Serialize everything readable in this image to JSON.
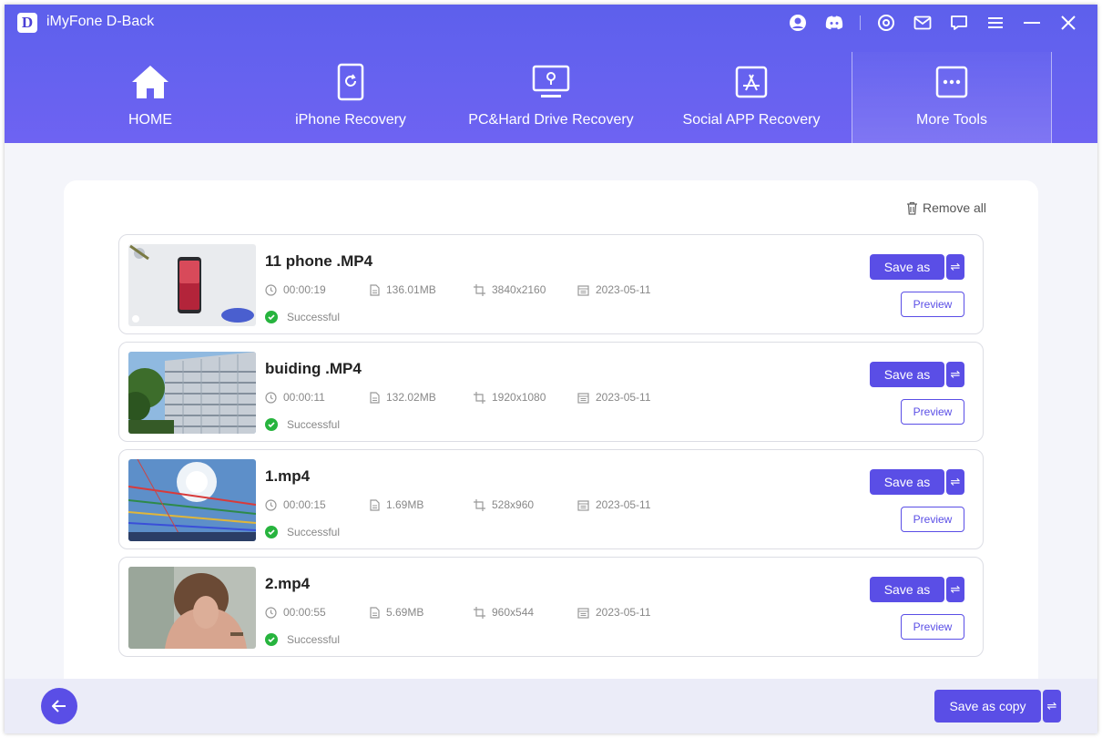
{
  "app": {
    "logo_letter": "D",
    "title": "iMyFone D-Back"
  },
  "titlebar_icons": [
    "user-icon",
    "discord-icon",
    "settings-icon",
    "mail-icon",
    "chat-icon",
    "menu-icon",
    "minimize-icon",
    "close-icon"
  ],
  "nav": [
    {
      "label": "HOME",
      "icon": "home-icon"
    },
    {
      "label": "iPhone Recovery",
      "icon": "iphone-recovery-icon"
    },
    {
      "label": "PC&Hard Drive Recovery",
      "icon": "pc-recovery-icon"
    },
    {
      "label": "Social APP Recovery",
      "icon": "app-store-icon"
    },
    {
      "label": "More Tools",
      "icon": "more-tools-icon",
      "active": true
    }
  ],
  "remove_all_label": "Remove all",
  "files": [
    {
      "name": "11 phone .MP4",
      "duration": "00:00:19",
      "size": "136.01MB",
      "resolution": "3840x2160",
      "date": "2023-05-11",
      "status": "Successful",
      "save_label": "Save as",
      "preview_label": "Preview",
      "swap_glyph": "⇌"
    },
    {
      "name": "buiding .MP4",
      "duration": "00:00:11",
      "size": "132.02MB",
      "resolution": "1920x1080",
      "date": "2023-05-11",
      "status": "Successful",
      "save_label": "Save as",
      "preview_label": "Preview",
      "swap_glyph": "⇌"
    },
    {
      "name": "1.mp4",
      "duration": "00:00:15",
      "size": "1.69MB",
      "resolution": "528x960",
      "date": "2023-05-11",
      "status": "Successful",
      "save_label": "Save as",
      "preview_label": "Preview",
      "swap_glyph": "⇌"
    },
    {
      "name": "2.mp4",
      "duration": "00:00:55",
      "size": "5.69MB",
      "resolution": "960x544",
      "date": "2023-05-11",
      "status": "Successful",
      "save_label": "Save as",
      "preview_label": "Preview",
      "swap_glyph": "⇌"
    }
  ],
  "footer": {
    "save_copy_label": "Save as copy",
    "swap_glyph": "⇌"
  },
  "colors": {
    "header": "#6461ee",
    "accent": "#5a4ee6",
    "success": "#27b43e"
  }
}
